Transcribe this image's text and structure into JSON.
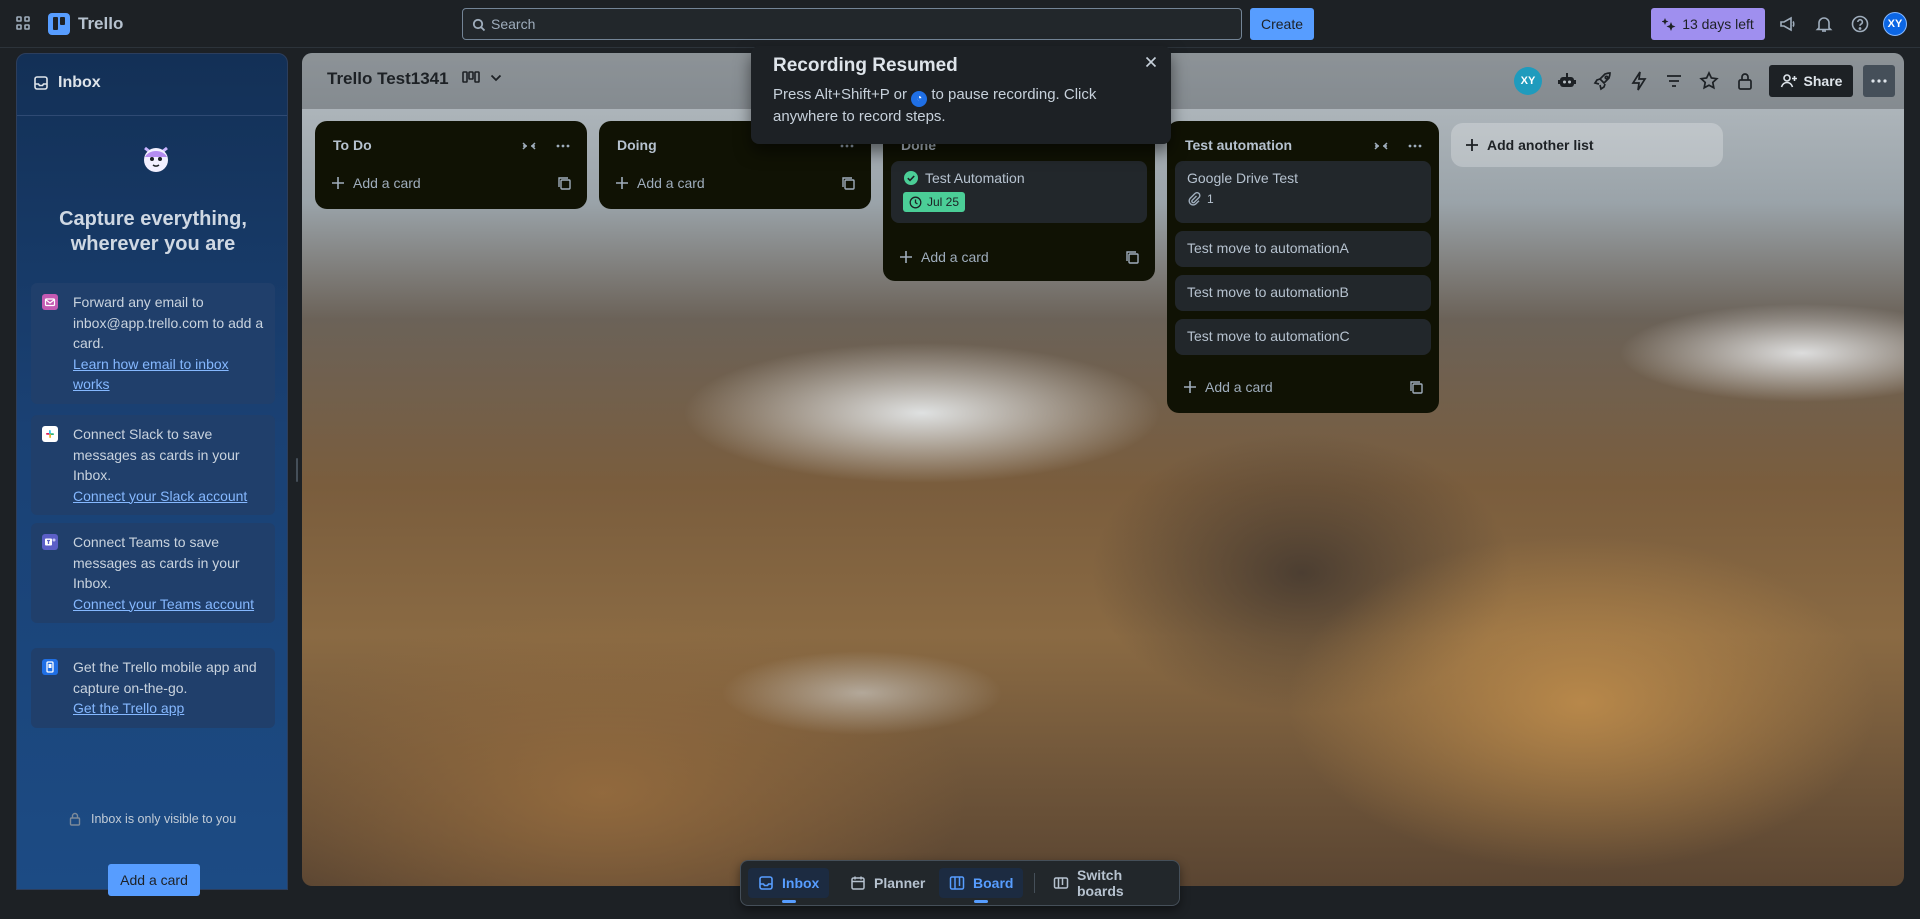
{
  "app": {
    "name": "Trello"
  },
  "search": {
    "placeholder": "Search"
  },
  "topbar": {
    "create_label": "Create",
    "trial_label": "13 days left",
    "user_initials": "XY",
    "icons": [
      "apps-icon",
      "megaphone-icon",
      "bell-icon",
      "help-icon"
    ]
  },
  "inbox": {
    "title": "Inbox",
    "headline": "Capture everything, wherever you are",
    "tips": [
      {
        "text": "Forward any email to inbox@app.trello.com to add a card.",
        "link": "Learn how email to inbox works",
        "icon": "email-icon",
        "color": "#c45ab3"
      },
      {
        "text": "Connect Slack to save messages as cards in your Inbox.",
        "link": "Connect your Slack account",
        "icon": "slack-icon",
        "color": "#ffffff"
      },
      {
        "text": "Connect Teams to save messages as cards in your Inbox.",
        "link": "Connect your Teams account",
        "icon": "teams-icon",
        "color": "#5b5fc7"
      },
      {
        "text": "Get the Trello mobile app and capture on-the-go.",
        "link": "Get the Trello app",
        "icon": "mobile-icon",
        "color": "#1f6fe5"
      }
    ],
    "visibility_note": "Inbox is only visible to you",
    "add_card_label": "Add a card"
  },
  "board": {
    "title": "Trello Test1341",
    "member_initials": "XY",
    "share_label": "Share",
    "add_list_label": "Add another list",
    "lists": [
      {
        "title": "To Do",
        "add_label": "Add a card",
        "cards": []
      },
      {
        "title": "Doing",
        "add_label": "Add a card",
        "cards": []
      },
      {
        "title": "Done",
        "add_label": "Add a card",
        "cards": [
          {
            "title": "Test Automation",
            "complete": true,
            "due": "Jul 25"
          }
        ]
      },
      {
        "title": "Test automation",
        "add_label": "Add a card",
        "cards": [
          {
            "title": "Google Drive Test",
            "attachments": "1"
          },
          {
            "title": "Test move to automationA"
          },
          {
            "title": "Test move to automationB"
          },
          {
            "title": "Test move to automationC"
          }
        ]
      }
    ]
  },
  "toast": {
    "title": "Recording Resumed",
    "body_before": "Press Alt+Shift+P or",
    "body_after": "to pause recording. Click anywhere to record steps."
  },
  "switcher": {
    "items": [
      {
        "label": "Inbox",
        "active": true
      },
      {
        "label": "Planner",
        "active": false
      },
      {
        "label": "Board",
        "active": true
      },
      {
        "label": "Switch boards",
        "active": false
      }
    ]
  },
  "colors": {
    "accent": "#579dff",
    "trial": "#9f8fef",
    "due_complete": "#4bce97",
    "list_bg": "#101204",
    "card_bg": "#22272b"
  }
}
